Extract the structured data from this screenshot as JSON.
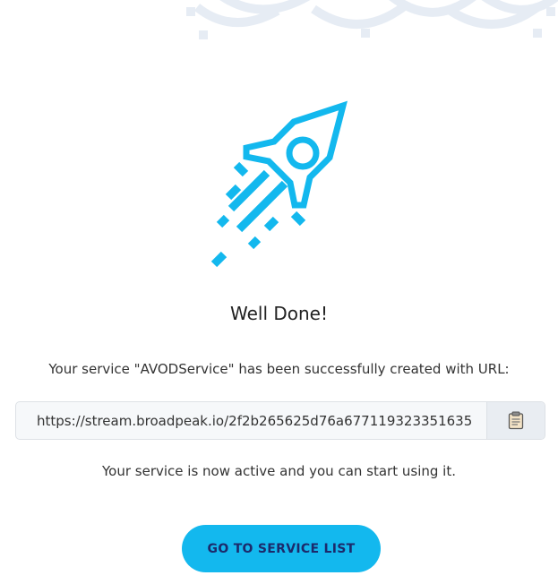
{
  "success": {
    "title": "Well Done!",
    "message": "Your service \"AVODService\" has been successfully created with URL:",
    "url": "https://stream.broadpeak.io/2f2b265625d76a677119323351635",
    "active_message": "Your service is now active and you can start using it.",
    "button_label": "GO TO SERVICE LIST"
  },
  "icons": {
    "hero": "rocket-icon",
    "copy": "clipboard-icon"
  },
  "colors": {
    "accent": "#13b8ee",
    "button_text": "#1c2a6b",
    "decoration": "#e6ecf4"
  }
}
